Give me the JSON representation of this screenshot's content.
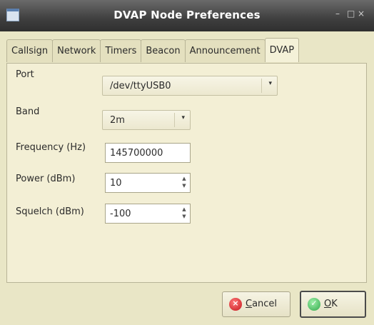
{
  "window": {
    "title": "DVAP Node Preferences",
    "minimize_glyph": "–",
    "maximize_glyph": "□",
    "close_glyph": "×"
  },
  "tabs": [
    {
      "label": "Callsign",
      "active": false
    },
    {
      "label": "Network",
      "active": false
    },
    {
      "label": "Timers",
      "active": false
    },
    {
      "label": "Beacon",
      "active": false
    },
    {
      "label": "Announcement",
      "active": false
    },
    {
      "label": "DVAP",
      "active": true
    }
  ],
  "form": {
    "port": {
      "label": "Port",
      "value": "/dev/ttyUSB0"
    },
    "band": {
      "label": "Band",
      "value": "2m"
    },
    "frequency": {
      "label": "Frequency (Hz)",
      "value": "145700000"
    },
    "power": {
      "label": "Power (dBm)",
      "value": "10"
    },
    "squelch": {
      "label": "Squelch (dBm)",
      "value": "-100"
    }
  },
  "buttons": {
    "cancel": {
      "mnemonic": "C",
      "rest": "ancel",
      "icon": "cancel-icon"
    },
    "ok": {
      "mnemonic": "O",
      "rest": "K",
      "icon": "ok-icon"
    }
  },
  "colors": {
    "dialog_bg": "#e9e6c6",
    "titlebar": "#3f3f3f",
    "cancel_icon": "#c4151b",
    "ok_icon": "#2fa84a"
  }
}
